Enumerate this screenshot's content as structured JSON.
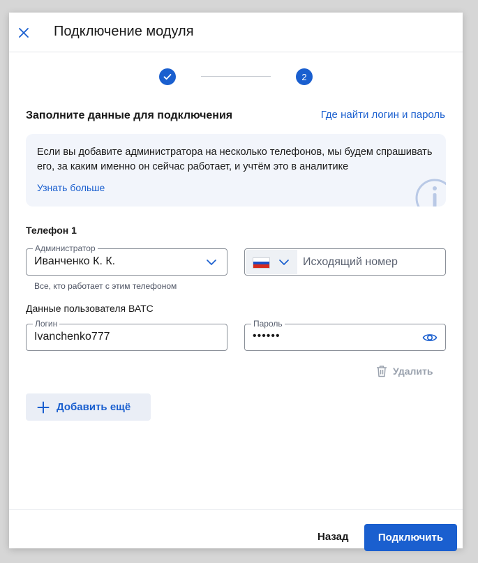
{
  "modal": {
    "title": "Подключение модуля",
    "close_icon": "close-icon"
  },
  "stepper": {
    "step1_state": "done",
    "step2_number": "2"
  },
  "form": {
    "section_title": "Заполните данные для подключения",
    "help_link": "Где найти логин и пароль",
    "info": {
      "text": "Если вы добавите администратора на несколько телефонов, мы будем спрашивать его, за каким именно он сейчас работает, и учтём это в аналитике",
      "link": "Узнать больше",
      "icon": "info-icon"
    },
    "phone": {
      "label": "Телефон 1",
      "admin_legend": "Администратор",
      "admin_value": "Иванченко К. К.",
      "admin_hint": "Все, кто работает с этим телефоном",
      "country_flag": "russia-flag",
      "outgoing_placeholder": "Исходящий номер"
    },
    "pbx": {
      "label": "Данные пользователя ВАТС",
      "login_legend": "Логин",
      "login_value": "Ivanchenko777",
      "password_legend": "Пароль",
      "password_value": "••••••"
    },
    "delete_label": "Удалить",
    "add_more_label": "Добавить ещё"
  },
  "footer": {
    "back_label": "Назад",
    "connect_label": "Подключить"
  },
  "colors": {
    "accent": "#1a5fcf",
    "info_bg": "#f2f5fb",
    "disabled": "#9aa2ae"
  }
}
